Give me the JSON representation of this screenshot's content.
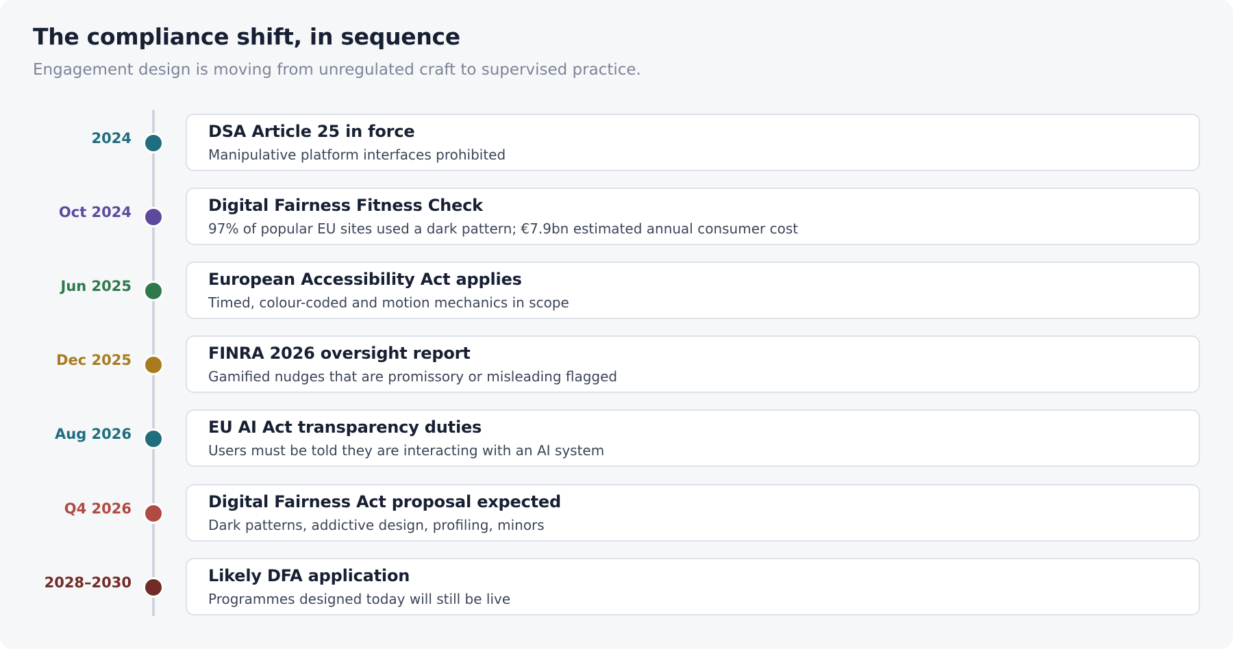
{
  "header": {
    "title": "The compliance shift, in sequence",
    "subtitle": "Engagement design is moving from unregulated craft to supervised practice."
  },
  "timeline": {
    "events": [
      {
        "date": "2024",
        "title": "DSA Article 25 in force",
        "description": "Manipulative platform interfaces prohibited",
        "color": "#1f6e7e"
      },
      {
        "date": "Oct 2024",
        "title": "Digital Fairness Fitness Check",
        "description": "97% of popular EU sites used a dark pattern; €7.9bn estimated annual consumer cost",
        "color": "#5e4a9c"
      },
      {
        "date": "Jun 2025",
        "title": "European Accessibility Act applies",
        "description": "Timed, colour-coded and motion mechanics in scope",
        "color": "#2e7a4c"
      },
      {
        "date": "Dec 2025",
        "title": "FINRA 2026 oversight report",
        "description": "Gamified nudges that are promissory or misleading flagged",
        "color": "#a87c1e"
      },
      {
        "date": "Aug 2026",
        "title": "EU AI Act transparency duties",
        "description": "Users must be told they are interacting with an AI system",
        "color": "#1f6e7e"
      },
      {
        "date": "Q4 2026",
        "title": "Digital Fairness Act proposal expected",
        "description": "Dark patterns, addictive design, profiling, minors",
        "color": "#b04a42"
      },
      {
        "date": "2028–2030",
        "title": "Likely DFA application",
        "description": "Programmes designed today will still be live",
        "color": "#722c26"
      }
    ]
  }
}
